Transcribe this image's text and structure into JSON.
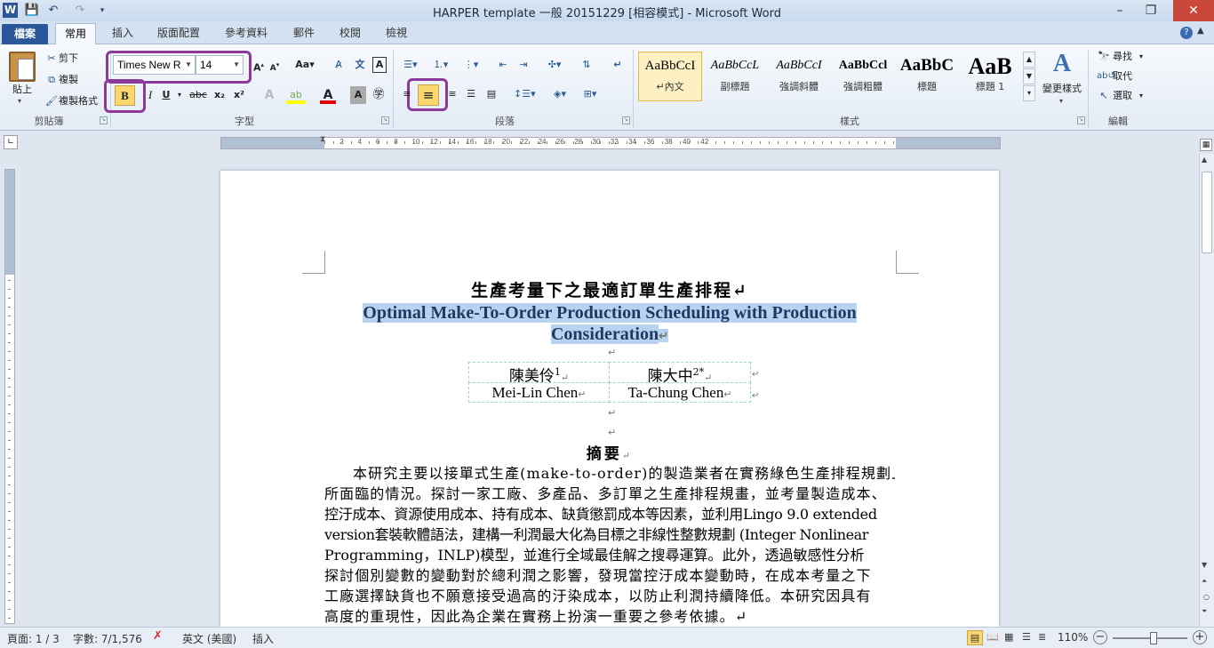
{
  "titlebar": {
    "title": "HARPER template 一般 20151229 [相容模式] - Microsoft Word",
    "word_logo": "W",
    "minimize": "–",
    "restore": "❐",
    "close": "✕"
  },
  "tabs": [
    "檔案",
    "常用",
    "插入",
    "版面配置",
    "參考資料",
    "郵件",
    "校閱",
    "檢視"
  ],
  "ribbon": {
    "clipboard": {
      "paste": "貼上",
      "cut": "剪下",
      "copy": "複製",
      "format_painter": "複製格式",
      "label": "剪貼簿"
    },
    "font": {
      "name": "Times New R",
      "size": "14",
      "bold": "B",
      "italic": "I",
      "underline": "U",
      "strike": "abc",
      "subscript": "x₂",
      "superscript": "x²",
      "label": "字型"
    },
    "paragraph": {
      "label": "段落"
    },
    "styles": {
      "items": [
        {
          "preview": "AaBbCcI",
          "name": "↵內文"
        },
        {
          "preview": "AaBbCcL",
          "name": "副標題"
        },
        {
          "preview": "AaBbCcI",
          "name": "強調斜體"
        },
        {
          "preview": "AaBbCcl",
          "name": "強調粗體"
        },
        {
          "preview": "AaBbC",
          "name": "標題"
        },
        {
          "preview": "AaB",
          "name": "標題 1"
        }
      ],
      "change": "變更樣式",
      "label": "樣式"
    },
    "editing": {
      "find": "尋找",
      "replace": "取代",
      "select": "選取",
      "label": "編輯"
    }
  },
  "ruler_numbers": [
    "6",
    "4",
    "2",
    "2",
    "4",
    "6",
    "8",
    "10",
    "12",
    "14",
    "16",
    "18",
    "20",
    "22",
    "24",
    "26",
    "28",
    "30",
    "32",
    "34",
    "36",
    "38",
    "40",
    "42"
  ],
  "document": {
    "title_zh": "生產考量下之最適訂單生產排程↵",
    "title_en_1": "Optimal Make-To-Order Production Scheduling with Production",
    "title_en_2": "Consideration",
    "authors": [
      {
        "zh": "陳美伶",
        "sup": "1",
        "en": "Mei-Lin Chen"
      },
      {
        "zh": "陳大中",
        "sup": "2*",
        "en": "Ta-Chung Chen"
      }
    ],
    "abstract_heading": "摘要",
    "abstract_lines": [
      "本研究主要以接單式生產(make-to-order)的製造業者在實務綠色生產排程規劃上",
      "所面臨的情況。探討一家工廠、多產品、多訂單之生產排程規畫，並考量製造成本、",
      "控汙成本、資源使用成本、持有成本、缺貨懲罰成本等因素，並利用Lingo 9.0 extended",
      "version套裝軟體語法，建構一利潤最大化為目標之非線性整數規劃 (Integer Nonlinear",
      "Programming，INLP)模型，並進行全域最佳解之搜尋運算。此外，透過敏感性分析",
      "探討個別變數的變動對於總利潤之影響，發現當控汙成本變動時，在成本考量之下",
      "工廠選擇缺貨也不願意接受過高的汙染成本，以防止利潤持續降低。本研究因具有",
      "高度的重現性，因此為企業在實務上扮演一重要之參考依據。↵"
    ]
  },
  "statusbar": {
    "page": "頁面: 1 / 3",
    "words": "字數: 7/1,576",
    "language": "英文 (美國)",
    "mode": "插入",
    "zoom": "110%"
  },
  "colors": {
    "accent": "#2b579a",
    "highlight_outline": "#8b3a9a",
    "selection": "#b8d3f0"
  }
}
